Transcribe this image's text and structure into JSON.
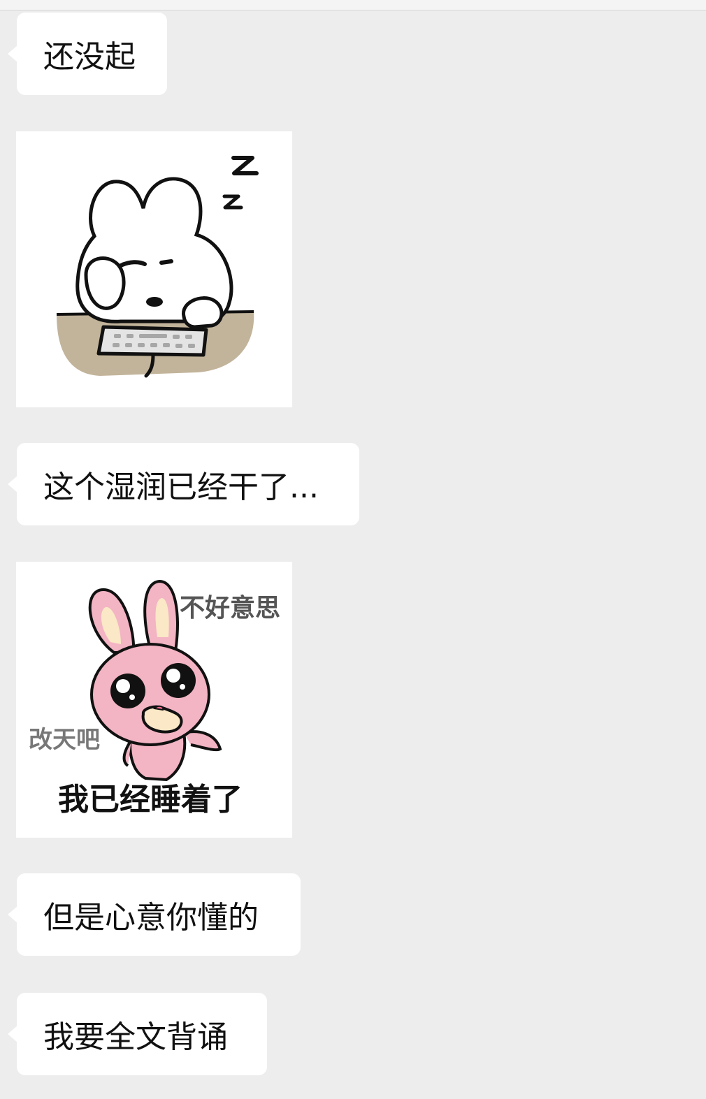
{
  "messages": [
    {
      "type": "text",
      "text": "还没起"
    },
    {
      "type": "sticker",
      "icon": "sleeping-bunny-keyboard-sticker"
    },
    {
      "type": "text",
      "text": "这个湿润已经干了..."
    },
    {
      "type": "sticker",
      "icon": "pink-bunny-sorry-sticker",
      "captions": {
        "top": "不好意思",
        "side": "改天吧",
        "bottom": "我已经睡着了"
      }
    },
    {
      "type": "text",
      "text": "但是心意你懂的"
    },
    {
      "type": "text",
      "text": "我要全文背诵"
    }
  ],
  "colors": {
    "background": "#ededed",
    "bubble": "#ffffff",
    "text": "#111111",
    "desk": "#c2b49a",
    "bunny_pink": "#f3b4c4"
  }
}
